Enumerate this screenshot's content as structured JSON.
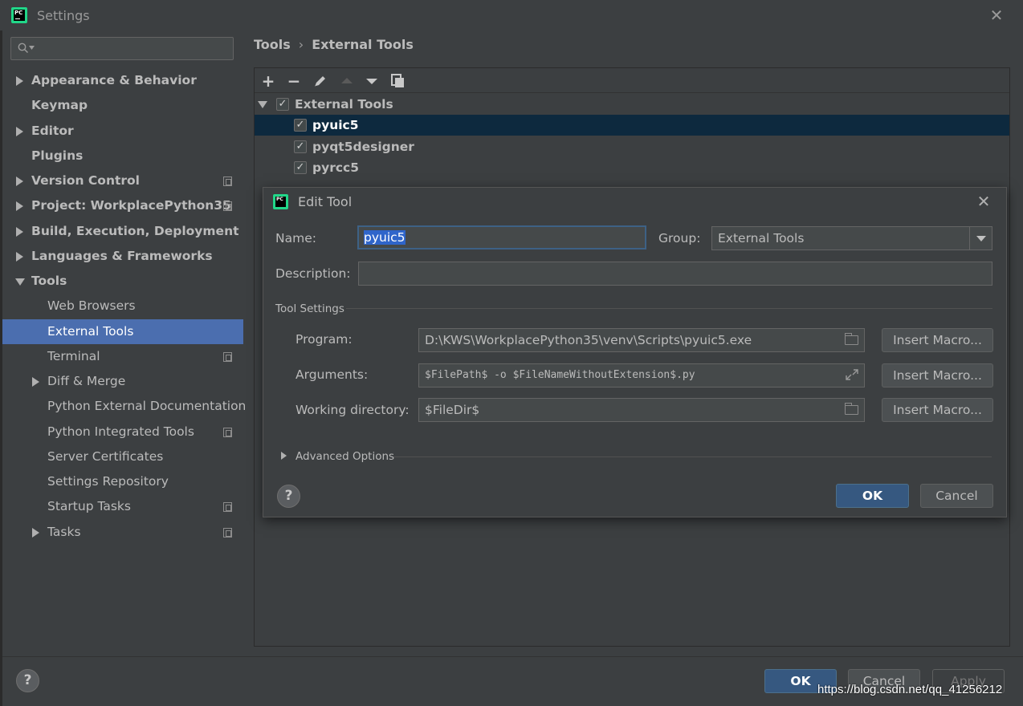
{
  "window": {
    "title": "Settings",
    "app_icon_text": "PC"
  },
  "search": {
    "placeholder": ""
  },
  "sidebar": {
    "items": [
      {
        "label": "Appearance & Behavior"
      },
      {
        "label": "Keymap"
      },
      {
        "label": "Editor"
      },
      {
        "label": "Plugins"
      },
      {
        "label": "Version Control"
      },
      {
        "label": "Project: WorkplacePython35"
      },
      {
        "label": "Build, Execution, Deployment"
      },
      {
        "label": "Languages & Frameworks"
      },
      {
        "label": "Tools"
      },
      {
        "label": "Web Browsers"
      },
      {
        "label": "External Tools"
      },
      {
        "label": "Terminal"
      },
      {
        "label": "Diff & Merge"
      },
      {
        "label": "Python External Documentation"
      },
      {
        "label": "Python Integrated Tools"
      },
      {
        "label": "Server Certificates"
      },
      {
        "label": "Settings Repository"
      },
      {
        "label": "Startup Tasks"
      },
      {
        "label": "Tasks"
      }
    ]
  },
  "breadcrumb": {
    "parent": "Tools",
    "separator": "›",
    "current": "External Tools"
  },
  "toolbar": {
    "add": "+",
    "remove": "−"
  },
  "tools_tree": {
    "group": {
      "label": "External Tools",
      "checked": true
    },
    "items": [
      {
        "label": "pyuic5",
        "checked": true
      },
      {
        "label": "pyqt5designer",
        "checked": true
      },
      {
        "label": "pyrcc5",
        "checked": true
      }
    ]
  },
  "edit_tool": {
    "title": "Edit Tool",
    "app_icon_text": "PC",
    "name_label": "Name:",
    "name_value": "pyuic5",
    "group_label": "Group:",
    "group_value": "External Tools",
    "description_label": "Description:",
    "description_value": "",
    "tool_settings_label": "Tool Settings",
    "program_label": "Program:",
    "program_value": "D:\\KWS\\WorkplacePython35\\venv\\Scripts\\pyuic5.exe",
    "arguments_label": "Arguments:",
    "arguments_value": "$FilePath$ -o $FileNameWithoutExtension$.py",
    "working_dir_label": "Working directory:",
    "working_dir_value": "$FileDir$",
    "insert_macro_label": "Insert Macro...",
    "advanced_options_label": "Advanced Options",
    "help_label": "?",
    "ok_label": "OK",
    "cancel_label": "Cancel"
  },
  "footer": {
    "help_label": "?",
    "ok_label": "OK",
    "cancel_label": "Cancel",
    "apply_label": "Apply"
  },
  "watermark": "https://blog.csdn.net/qq_41256212",
  "colors": {
    "background": "#3c3f41",
    "selection": "#4b6eaf",
    "tree_selection": "#0d293e",
    "primary_button": "#365880"
  }
}
